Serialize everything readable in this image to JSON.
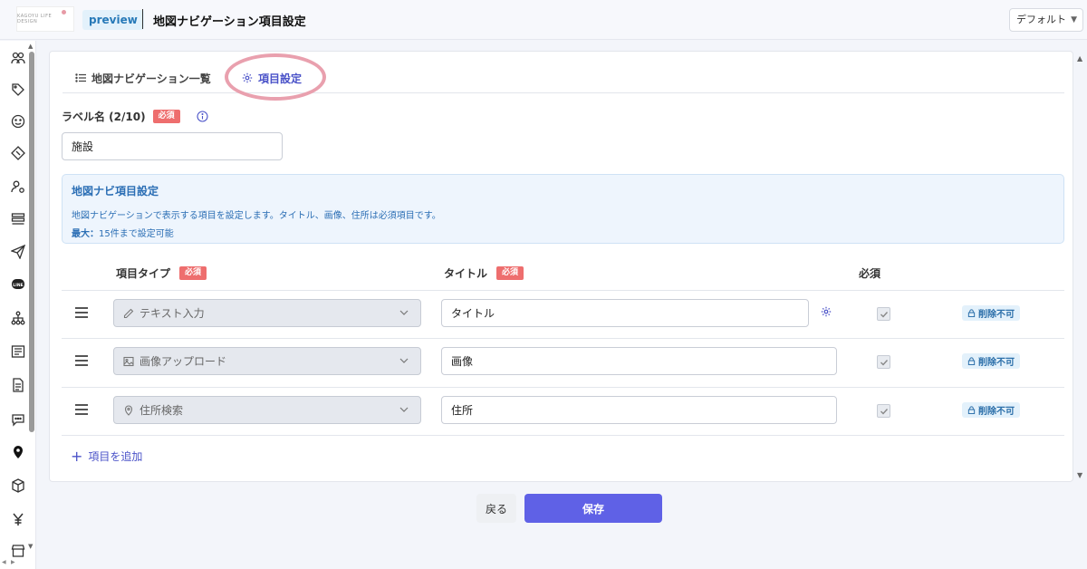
{
  "header": {
    "logo_text": "KAGOYU LIFE DESIGN",
    "preview_badge": "preview",
    "page_title": "地図ナビゲーション項目設定",
    "view_select": "デフォルト"
  },
  "tabs": [
    {
      "label": "地図ナビゲーション一覧",
      "icon": "list-icon"
    },
    {
      "label": "項目設定",
      "icon": "gear-icon",
      "active": true
    }
  ],
  "label_field": {
    "label": "ラベル名 (2/10)",
    "required": "必須",
    "value": "施設"
  },
  "info": {
    "title": "地図ナビ項目設定",
    "description": "地図ナビゲーションで表示する項目を設定します。タイトル、画像、住所は必須項目です。",
    "max_label": "最大：",
    "max_value": "15件まで設定可能"
  },
  "columns": {
    "type": "項目タイプ",
    "title": "タイトル",
    "required": "必須",
    "required_badge": "必須"
  },
  "rows": [
    {
      "type": "テキスト入力",
      "type_icon": "pencil-icon",
      "title": "タイトル",
      "required": true,
      "status": "削除不可"
    },
    {
      "type": "画像アップロード",
      "type_icon": "image-icon",
      "title": "画像",
      "required": true,
      "status": "削除不可"
    },
    {
      "type": "住所検索",
      "type_icon": "pin-icon",
      "title": "住所",
      "required": true,
      "status": "削除不可"
    }
  ],
  "add_item": "項目を追加",
  "footer": {
    "back": "戻る",
    "save": "保存"
  },
  "colors": {
    "accent": "#5f61e6",
    "required": "#ee6e6e",
    "info_bg": "#eef5fd",
    "highlight": "#e9a0ae"
  }
}
